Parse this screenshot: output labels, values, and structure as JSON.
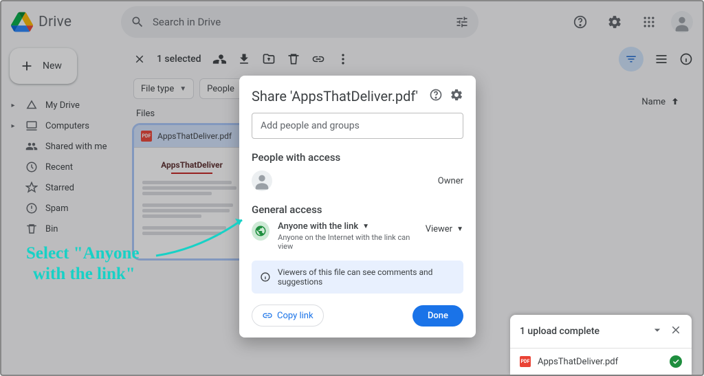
{
  "app": {
    "title": "Drive"
  },
  "search": {
    "placeholder": "Search in Drive"
  },
  "new_button": "New",
  "nav": {
    "my_drive": "My Drive",
    "computers": "Computers",
    "shared": "Shared with me",
    "recent": "Recent",
    "starred": "Starred",
    "spam": "Spam",
    "bin": "Bin"
  },
  "toolbar": {
    "selected": "1 selected"
  },
  "chips": {
    "file_type": "File type",
    "people": "People"
  },
  "files_label": "Files",
  "columns": {
    "name": "Name"
  },
  "file": {
    "name": "AppsThatDeliver.pdf",
    "thumb_title": "AppsThatDeliver"
  },
  "dialog": {
    "title": "Share 'AppsThatDeliver.pdf'",
    "input_placeholder": "Add people and groups",
    "people_section": "People with access",
    "owner_role": "Owner",
    "general_section": "General access",
    "access_label": "Anyone with the link",
    "access_sub": "Anyone on the Internet with the link can view",
    "viewer": "Viewer",
    "info": "Viewers of this file can see comments and suggestions",
    "copy_link": "Copy link",
    "done": "Done"
  },
  "toast": {
    "title": "1 upload complete",
    "file": "AppsThatDeliver.pdf"
  },
  "annotation": {
    "line1": "Select \"Anyone",
    "line2": "with the link\""
  }
}
